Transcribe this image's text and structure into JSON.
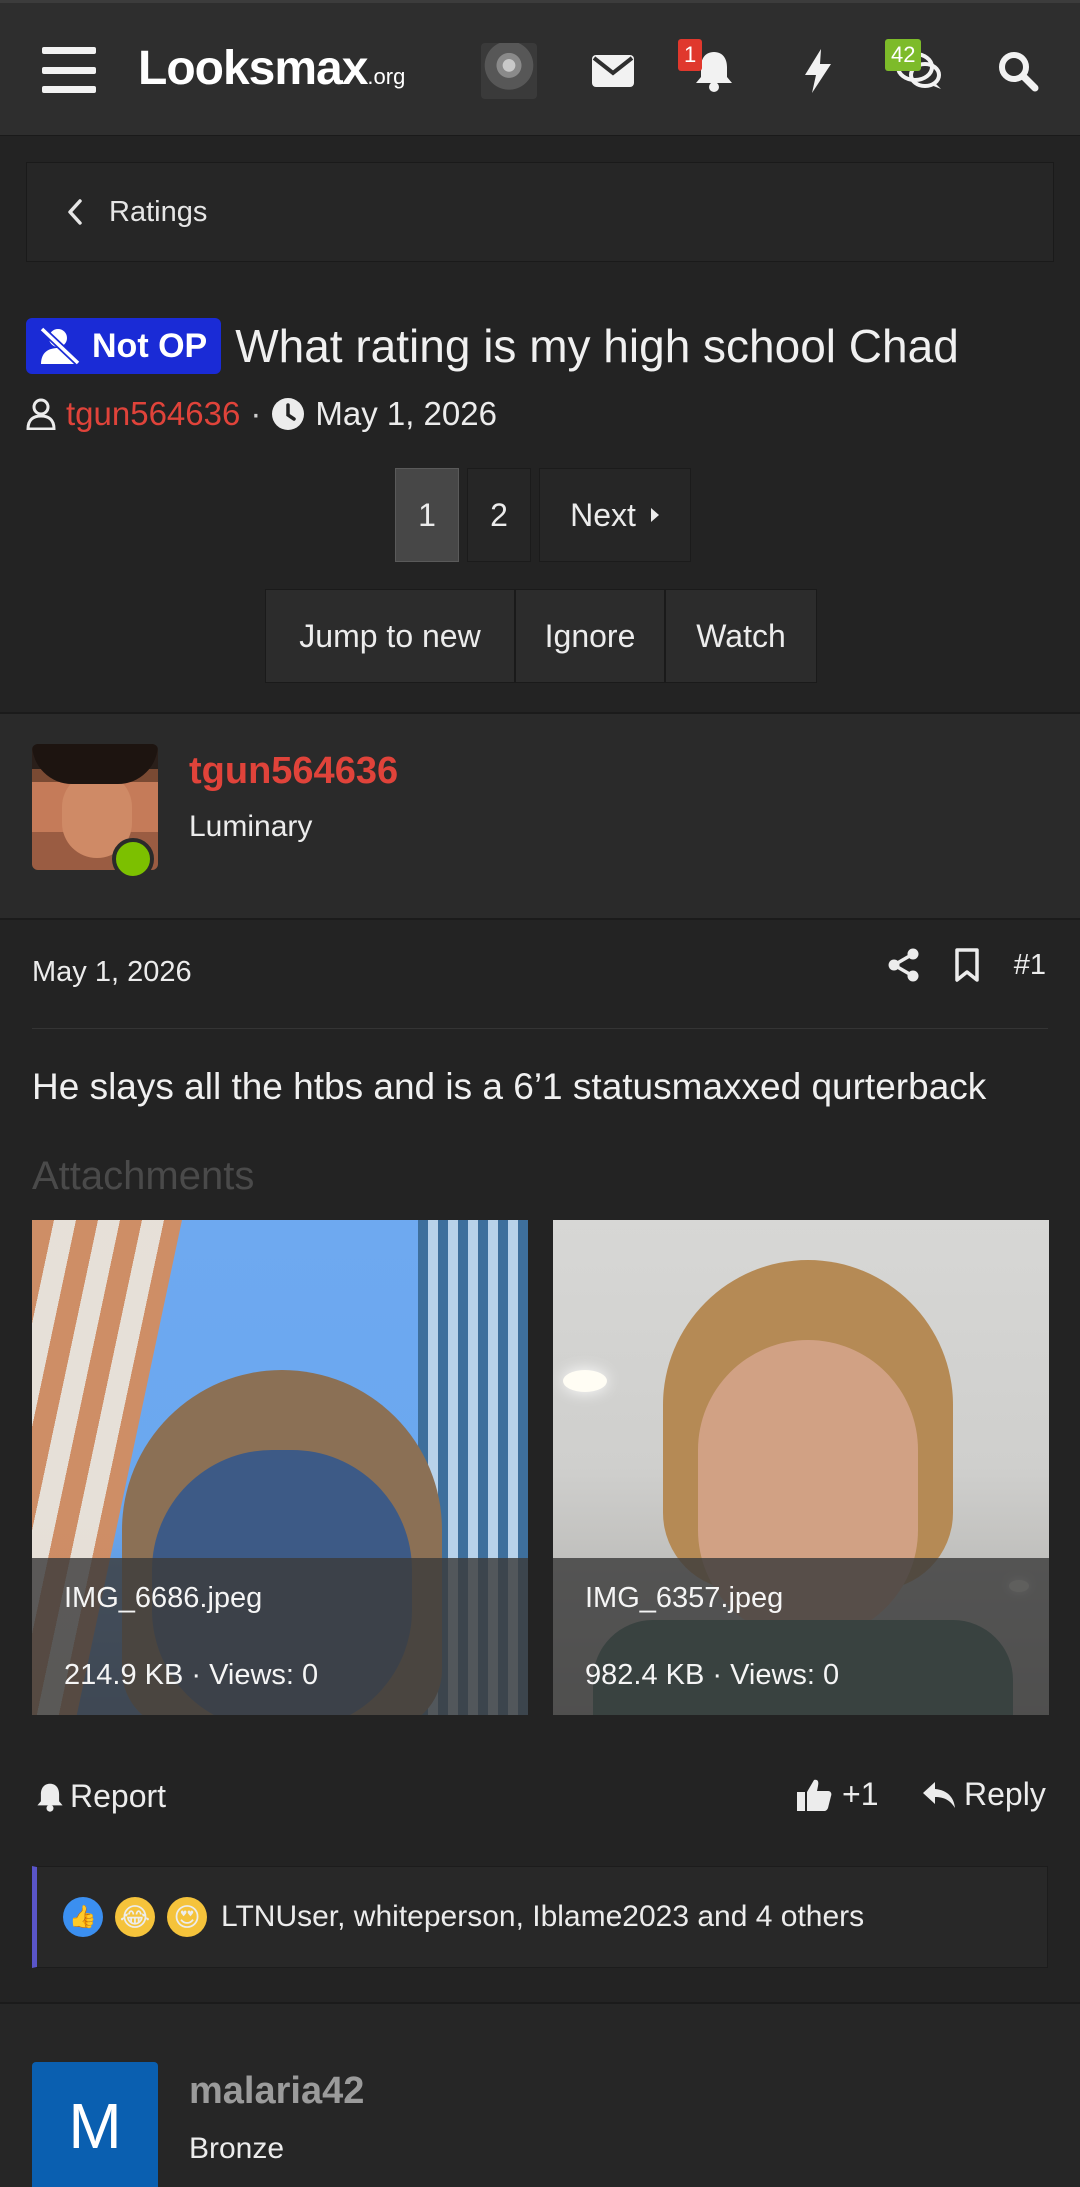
{
  "header": {
    "logo_text": "Lᴏᴏksmax",
    "logo_tld": ".org",
    "alerts_badge": "1",
    "conversations_badge": "42"
  },
  "breadcrumb": {
    "label": "Ratings"
  },
  "thread": {
    "prefix": "Not OP",
    "title": "What rating is my high school Chad",
    "author": "tgun564636",
    "date": "May 1, 2026"
  },
  "pagination": {
    "pages": [
      "1",
      "2"
    ],
    "next_label": "Next"
  },
  "thread_actions": {
    "jump": "Jump to new",
    "ignore": "Ignore",
    "watch": "Watch"
  },
  "post": {
    "username": "tgun564636",
    "user_title": "Luminary",
    "date": "May 1, 2026",
    "number": "#1",
    "body": "He slays all the htbs and is a 6’1 statusmaxxed qurterback",
    "attachments_label": "Attachments",
    "attachments": [
      {
        "name": "IMG_6686.jpeg",
        "meta": "214.9 KB · Views: 0"
      },
      {
        "name": "IMG_6357.jpeg",
        "meta": "982.4 KB · Views: 0"
      }
    ],
    "report_label": "Report",
    "like_label": "+1",
    "reply_label": "Reply",
    "reactions_text": "LTNUser, whiteperson, Iblame2023 and 4 others"
  },
  "next_post": {
    "avatar_letter": "M",
    "username": "malaria42",
    "user_title": "Bronze"
  },
  "colors": {
    "accent_red": "#e0433a",
    "not_op_blue": "#1a2bd6",
    "online_green": "#7cc000"
  }
}
